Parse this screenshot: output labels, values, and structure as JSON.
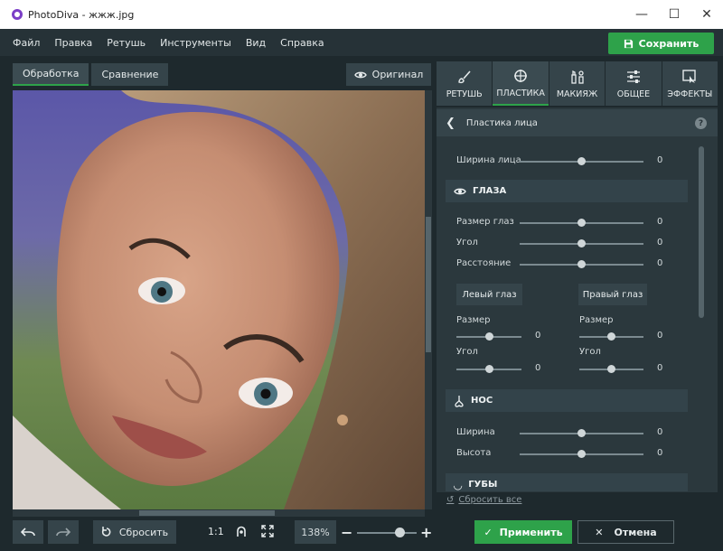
{
  "window": {
    "app_name": "PhotoDiva",
    "file": "жжж.jpg",
    "title": "PhotoDiva - жжж.jpg"
  },
  "menu": [
    "Файл",
    "Правка",
    "Ретушь",
    "Инструменты",
    "Вид",
    "Справка"
  ],
  "save_button": "Сохранить",
  "view_tabs": [
    "Обработка",
    "Сравнение"
  ],
  "original_button": "Оригинал",
  "panel_tabs": [
    {
      "label": "РЕТУШЬ",
      "icon": "brush-icon"
    },
    {
      "label": "ПЛАСТИКА",
      "icon": "plastic-icon"
    },
    {
      "label": "МАКИЯЖ",
      "icon": "makeup-icon"
    },
    {
      "label": "ОБЩЕЕ",
      "icon": "sliders-icon"
    },
    {
      "label": "ЭФФЕКТЫ",
      "icon": "effects-icon"
    }
  ],
  "panel": {
    "title": "Пластика лица",
    "face_width": {
      "label": "Ширина лица",
      "value": "0"
    },
    "eyes_section": "ГЛАЗА",
    "eyes": [
      {
        "label": "Размер глаз",
        "value": "0"
      },
      {
        "label": "Угол",
        "value": "0"
      },
      {
        "label": "Расстояние",
        "value": "0"
      }
    ],
    "left_eye_button": "Левый глаз",
    "right_eye_button": "Правый глаз",
    "left_eye": [
      {
        "label": "Размер",
        "value": "0"
      },
      {
        "label": "Угол",
        "value": "0"
      }
    ],
    "right_eye": [
      {
        "label": "Размер",
        "value": "0"
      },
      {
        "label": "Угол",
        "value": "0"
      }
    ],
    "nose_section": "НОС",
    "nose": [
      {
        "label": "Ширина",
        "value": "0"
      },
      {
        "label": "Высота",
        "value": "0"
      }
    ],
    "lips_section": "ГУБЫ"
  },
  "reset_all": "Сбросить все",
  "bottom": {
    "reset": "Сбросить",
    "ratio": "1:1",
    "zoom": "138%",
    "apply": "Применить",
    "cancel": "Отмена"
  },
  "colors": {
    "accent": "#2ea24a",
    "background": "#1e292d",
    "panel": "#2b383d"
  }
}
